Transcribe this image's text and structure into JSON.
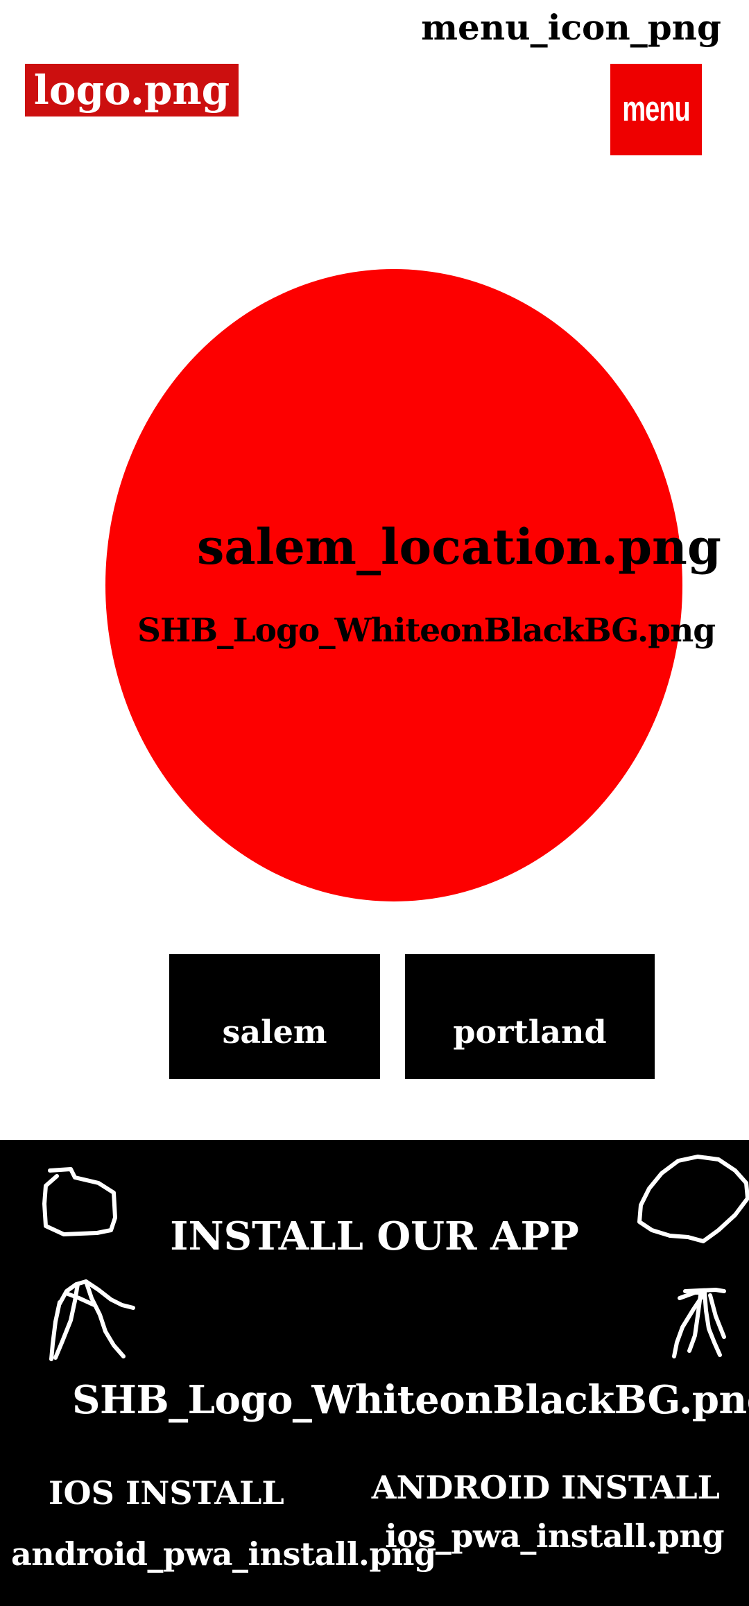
{
  "header": {
    "menu_icon_caption": "menu_icon_png",
    "logo_text": "logo.png",
    "menu_button_label": "menu",
    "logo_bg_color": "#cc0f0f",
    "menu_bg_color": "#ee0000"
  },
  "hero": {
    "title": "salem_location.png",
    "subtitle": "SHB_Logo_WhiteonBlackBG.png",
    "circle_color": "#fd0000"
  },
  "locations": {
    "items": [
      {
        "label": "salem"
      },
      {
        "label": "portland"
      }
    ]
  },
  "footer": {
    "install_title": "INSTALL OUR APP",
    "logo_text": "SHB_Logo_WhiteonBlackBG.png",
    "ios_install_label": "IOS INSTALL",
    "android_install_label": "ANDROID INSTALL",
    "android_image_text": "android_pwa_install.png",
    "ios_image_text": "ios_pwa_install.png",
    "left_doodle_icon": "hand-drawn-doodle-icon",
    "right_doodle_icon": "hand-drawn-doodle-icon"
  }
}
